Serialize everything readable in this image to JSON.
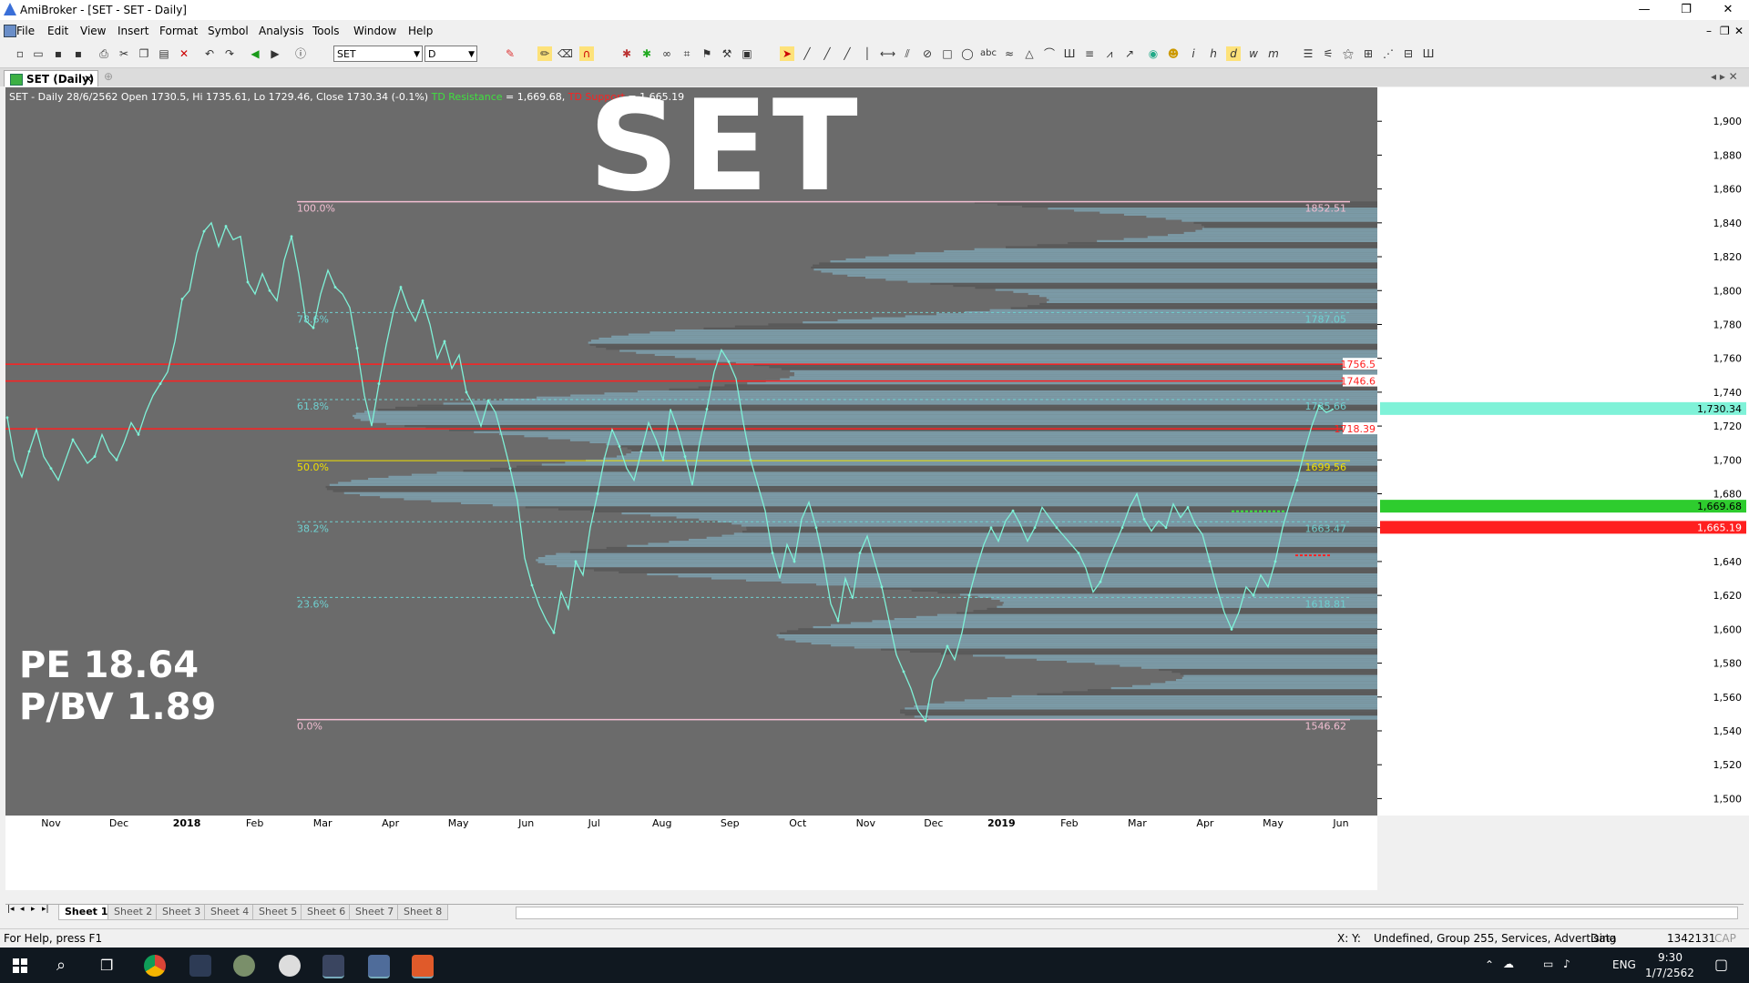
{
  "app": {
    "title": "AmiBroker - [SET - SET - Daily]",
    "window_buttons": [
      "—",
      "❐",
      "✕"
    ],
    "mdi_buttons": [
      "–",
      "❐",
      "✕"
    ]
  },
  "menu": [
    "File",
    "Edit",
    "View",
    "Insert",
    "Format",
    "Symbol",
    "Analysis",
    "Tools",
    "Window",
    "Help"
  ],
  "toolbar": {
    "symbol_value": "SET",
    "interval_value": "D"
  },
  "doc_tab": {
    "label": "SET (Daily)"
  },
  "chart": {
    "title_big": "SET",
    "info_prefix": "SET - Daily 28/6/2562 Open 1730.5, Hi 1735.61, Lo 1729.46, Close 1730.34 (-0.1%)",
    "td_resistance_label": "TD Resistance",
    "td_resistance_value": " = 1,669.68, ",
    "td_support_label": "TD Support",
    "td_support_value": " = 1,665.19",
    "pe": "PE 18.64",
    "pbv": "P/BV 1.89",
    "colors": {
      "background": "#6b6b6b",
      "price_line": "#7ff2d8",
      "volume_profile_light": "#7b9aa6",
      "volume_profile_dark": "#5a5a5a",
      "red": "#ff2020",
      "green": "#3fe03f",
      "fib_pink": "#f2bed2",
      "fib_yellow": "#f0e000",
      "fib_cyan": "#6fd0d0"
    }
  },
  "chart_data": {
    "type": "line",
    "title": "SET",
    "ylim": [
      1490,
      1920
    ],
    "y_ticks": [
      1500,
      1520,
      1540,
      1560,
      1580,
      1600,
      1620,
      1640,
      1660,
      1680,
      1700,
      1720,
      1740,
      1760,
      1780,
      1800,
      1820,
      1840,
      1860,
      1880,
      1900
    ],
    "x_labels": [
      "Nov",
      "Dec",
      "2018",
      "Feb",
      "Mar",
      "Apr",
      "May",
      "Jun",
      "Jul",
      "Aug",
      "Sep",
      "Oct",
      "Nov",
      "Dec",
      "2019",
      "Feb",
      "Mar",
      "Apr",
      "May",
      "Jun"
    ],
    "x_label_bold": [
      "2018",
      "2019"
    ],
    "series": [
      {
        "values": [
          1725,
          1700,
          1690,
          1705,
          1718,
          1702,
          1695,
          1688,
          1700,
          1712,
          1705,
          1698,
          1702,
          1715,
          1705,
          1700,
          1710,
          1722,
          1715,
          1728,
          1738,
          1745,
          1752,
          1770,
          1795,
          1800,
          1822,
          1835,
          1840,
          1826,
          1838,
          1830,
          1832,
          1805,
          1798,
          1810,
          1800,
          1794,
          1818,
          1832,
          1810,
          1782,
          1778,
          1798,
          1812,
          1802,
          1798,
          1790,
          1766,
          1738,
          1720,
          1745,
          1768,
          1788,
          1802,
          1790,
          1782,
          1794,
          1780,
          1760,
          1770,
          1754,
          1762,
          1740,
          1732,
          1720,
          1735,
          1728,
          1712,
          1695,
          1676,
          1642,
          1626,
          1614,
          1605,
          1598,
          1622,
          1612,
          1640,
          1632,
          1660,
          1680,
          1702,
          1718,
          1708,
          1695,
          1688,
          1705,
          1722,
          1712,
          1700,
          1730,
          1718,
          1702,
          1685,
          1710,
          1730,
          1752,
          1765,
          1758,
          1748,
          1722,
          1700,
          1685,
          1670,
          1645,
          1630,
          1650,
          1640,
          1665,
          1675,
          1660,
          1640,
          1615,
          1605,
          1630,
          1618,
          1645,
          1655,
          1640,
          1625,
          1605,
          1585,
          1575,
          1565,
          1552,
          1546,
          1570,
          1578,
          1590,
          1582,
          1598,
          1620,
          1636,
          1650,
          1660,
          1652,
          1664,
          1670,
          1662,
          1652,
          1660,
          1672,
          1666,
          1660,
          1655,
          1650,
          1645,
          1636,
          1622,
          1628,
          1640,
          1650,
          1660,
          1672,
          1680,
          1665,
          1658,
          1664,
          1660,
          1674,
          1666,
          1672,
          1662,
          1656,
          1640,
          1624,
          1610,
          1600,
          1610,
          1625,
          1620,
          1632,
          1625,
          1640,
          1660,
          1675,
          1688,
          1705,
          1720,
          1732,
          1728,
          1730
        ]
      }
    ],
    "fib_levels": [
      {
        "label": "100.0%",
        "value": "1852.51"
      },
      {
        "label": "78.6%",
        "value": "1787.05"
      },
      {
        "label": "61.8%",
        "value": "1735.66"
      },
      {
        "label": "50.0%",
        "value": "1699.56"
      },
      {
        "label": "38.2%",
        "value": "1663.47"
      },
      {
        "label": "23.6%",
        "value": "1618.81"
      },
      {
        "label": "0.0%",
        "value": "1546.62"
      }
    ],
    "red_lines": [
      "1756.5",
      "1746.6",
      "1718.39"
    ],
    "last_price": "1,730.34",
    "td_resistance": "1,669.68",
    "td_support": "1,665.19",
    "last_price_value": 1730.34,
    "td_resistance_level": 1669.68,
    "td_support_level": 1665.19
  },
  "sheets": {
    "nav": [
      "|◂",
      "◂",
      "▸",
      "▸|"
    ],
    "tabs": [
      "Sheet 1",
      "Sheet 2",
      "Sheet 3",
      "Sheet 4",
      "Sheet 5",
      "Sheet 6",
      "Sheet 7",
      "Sheet 8"
    ]
  },
  "status": {
    "left": "For Help, press F1",
    "coords": "X:  Y:",
    "group": "Undefined, Group 255, Services, Advertising",
    "data": "Data",
    "count": "1342131",
    "cap": "CAP"
  },
  "taskbar": {
    "lang": "ENG",
    "time": "9:30",
    "date": "1/7/2562"
  }
}
